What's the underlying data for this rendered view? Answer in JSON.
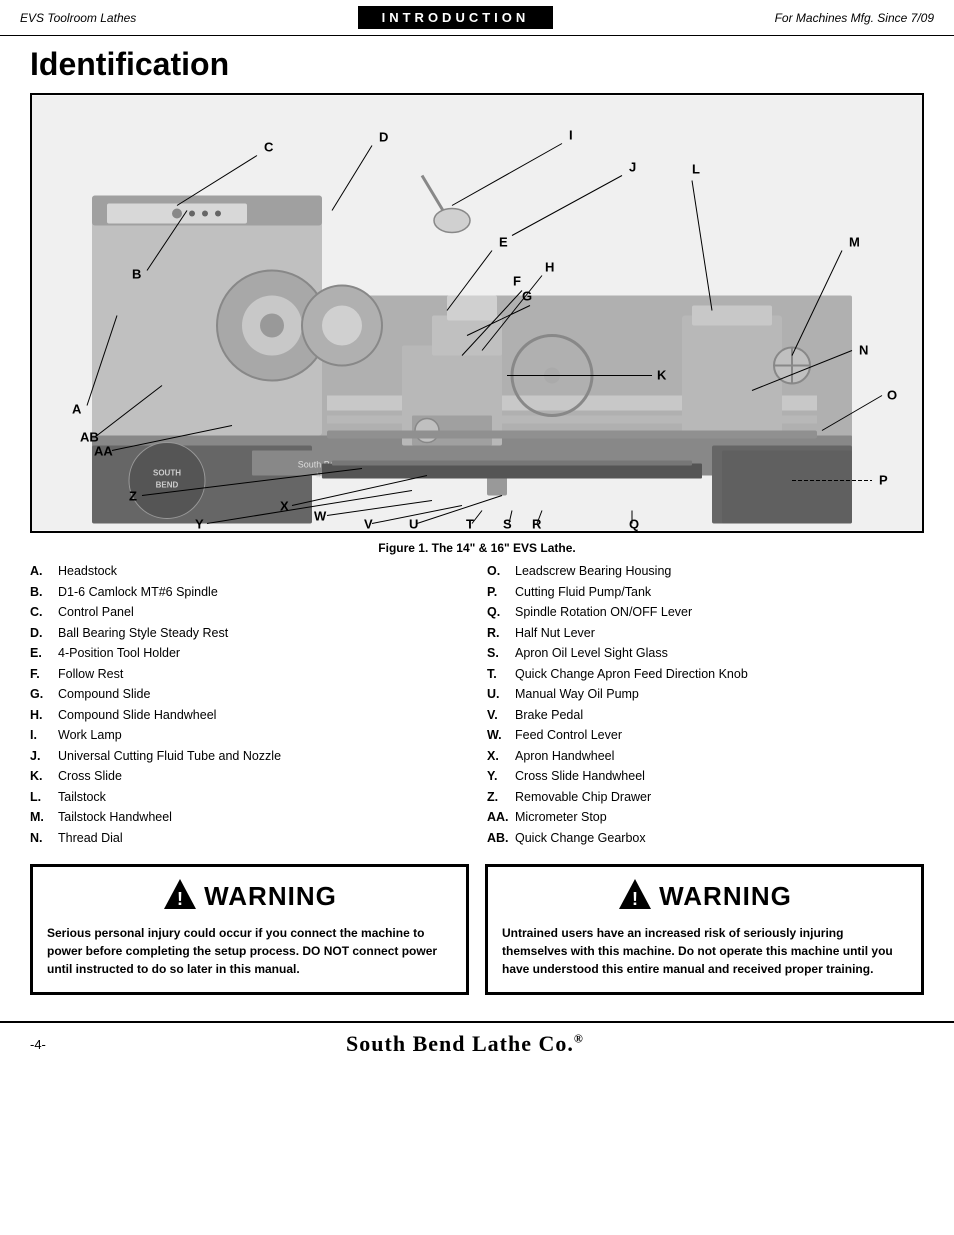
{
  "header": {
    "left": "EVS Toolroom Lathes",
    "center": "INTRODUCTION",
    "right": "For Machines Mfg. Since 7/09"
  },
  "page_title": "Identification",
  "figure_caption": "Figure 1. The 14\" & 16\" EVS Lathe.",
  "labels": [
    "A",
    "B",
    "C",
    "D",
    "E",
    "F",
    "G",
    "H",
    "I",
    "J",
    "K",
    "L",
    "M",
    "N",
    "O",
    "P",
    "Q",
    "R",
    "S",
    "T",
    "U",
    "V",
    "W",
    "X",
    "Y",
    "Z",
    "AA",
    "AB"
  ],
  "identification_left": [
    {
      "letter": "A.",
      "text": "Headstock"
    },
    {
      "letter": "B.",
      "text": "D1-6 Camlock MT#6 Spindle"
    },
    {
      "letter": "C.",
      "text": "Control Panel"
    },
    {
      "letter": "D.",
      "text": "Ball Bearing Style Steady Rest"
    },
    {
      "letter": "E.",
      "text": "4-Position Tool Holder"
    },
    {
      "letter": "F.",
      "text": "Follow Rest"
    },
    {
      "letter": "G.",
      "text": "Compound Slide"
    },
    {
      "letter": "H.",
      "text": "Compound Slide Handwheel"
    },
    {
      "letter": "I.",
      "text": "Work Lamp"
    },
    {
      "letter": "J.",
      "text": "Universal Cutting Fluid Tube and Nozzle"
    },
    {
      "letter": "K.",
      "text": "Cross Slide"
    },
    {
      "letter": "L.",
      "text": "Tailstock"
    },
    {
      "letter": "M.",
      "text": "Tailstock Handwheel"
    },
    {
      "letter": "N.",
      "text": "Thread Dial"
    }
  ],
  "identification_right": [
    {
      "letter": "O.",
      "text": "Leadscrew Bearing Housing"
    },
    {
      "letter": "P.",
      "text": "Cutting Fluid Pump/Tank"
    },
    {
      "letter": "Q.",
      "text": "Spindle Rotation ON/OFF Lever"
    },
    {
      "letter": "R.",
      "text": "Half Nut Lever"
    },
    {
      "letter": "S.",
      "text": "Apron Oil Level Sight Glass"
    },
    {
      "letter": "T.",
      "text": "Quick Change Apron Feed Direction Knob"
    },
    {
      "letter": "U.",
      "text": "Manual Way Oil Pump"
    },
    {
      "letter": "V.",
      "text": "Brake Pedal"
    },
    {
      "letter": "W.",
      "text": "Feed Control Lever"
    },
    {
      "letter": "X.",
      "text": "Apron Handwheel"
    },
    {
      "letter": "Y.",
      "text": "Cross Slide Handwheel"
    },
    {
      "letter": "Z.",
      "text": "Removable Chip Drawer"
    },
    {
      "letter": "AA.",
      "text": "Micrometer Stop"
    },
    {
      "letter": "AB.",
      "text": "Quick Change Gearbox"
    }
  ],
  "warnings": [
    {
      "title": "WARNING",
      "text": "Serious personal injury could occur if you connect the machine to power before completing the setup process. DO NOT connect power until instructed to do so later in this manual."
    },
    {
      "title": "WARNING",
      "text": "Untrained users have an increased risk of seriously injuring themselves with this machine. Do not operate this machine until you have understood this entire manual and received proper training."
    }
  ],
  "footer": {
    "page_number": "-4-",
    "brand": "South Bend Lathe Co."
  }
}
